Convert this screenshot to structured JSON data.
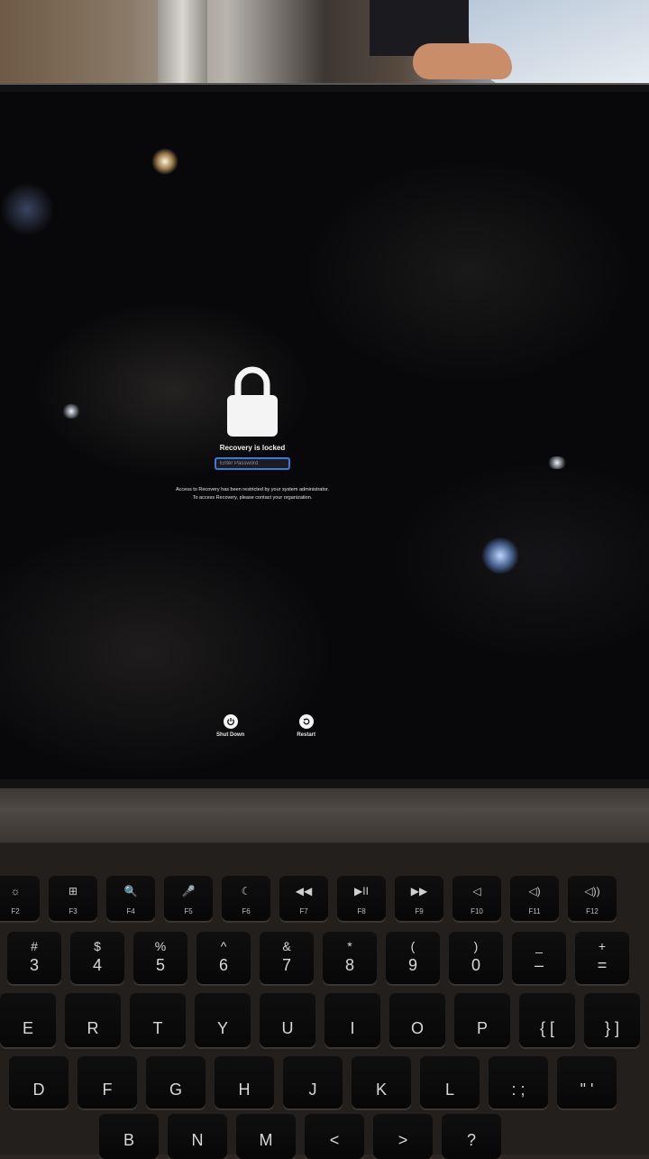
{
  "lock_screen": {
    "title": "Recovery is locked",
    "password_placeholder": "Enter Password",
    "message_line_1": "Access to Recovery has been restricted by your system administrator.",
    "message_line_2": "To access Recovery, please contact your organization."
  },
  "controls": {
    "shut_down_label": "Shut Down",
    "restart_label": "Restart"
  },
  "colors": {
    "accent": "#3d79d9",
    "screen_background": "#08080a"
  },
  "keyboard": {
    "function_row": [
      {
        "symbol": "☼",
        "fn": "F2"
      },
      {
        "symbol": "⊞",
        "fn": "F3"
      },
      {
        "symbol": "🔍",
        "fn": "F4"
      },
      {
        "symbol": "🎤",
        "fn": "F5"
      },
      {
        "symbol": "☾",
        "fn": "F6"
      },
      {
        "symbol": "◀◀",
        "fn": "F7"
      },
      {
        "symbol": "▶II",
        "fn": "F8"
      },
      {
        "symbol": "▶▶",
        "fn": "F9"
      },
      {
        "symbol": "◁",
        "fn": "F10"
      },
      {
        "symbol": "◁)",
        "fn": "F11"
      },
      {
        "symbol": "◁))",
        "fn": "F12"
      }
    ],
    "number_row": [
      {
        "top": "#",
        "main": "3"
      },
      {
        "top": "$",
        "main": "4"
      },
      {
        "top": "%",
        "main": "5"
      },
      {
        "top": "^",
        "main": "6"
      },
      {
        "top": "&",
        "main": "7"
      },
      {
        "top": "*",
        "main": "8"
      },
      {
        "top": "(",
        "main": "9"
      },
      {
        "top": ")",
        "main": "0"
      },
      {
        "top": "_",
        "main": "–"
      },
      {
        "top": "+",
        "main": "="
      }
    ],
    "top_row": [
      "E",
      "R",
      "T",
      "Y",
      "U",
      "I",
      "O",
      "P",
      "{ [",
      "} ]"
    ],
    "home_row": [
      "D",
      "F",
      "G",
      "H",
      "J",
      "K",
      "L",
      ": ;",
      "\" '"
    ],
    "bottom_row": [
      "B",
      "N",
      "M",
      "<",
      ">",
      "?"
    ]
  }
}
